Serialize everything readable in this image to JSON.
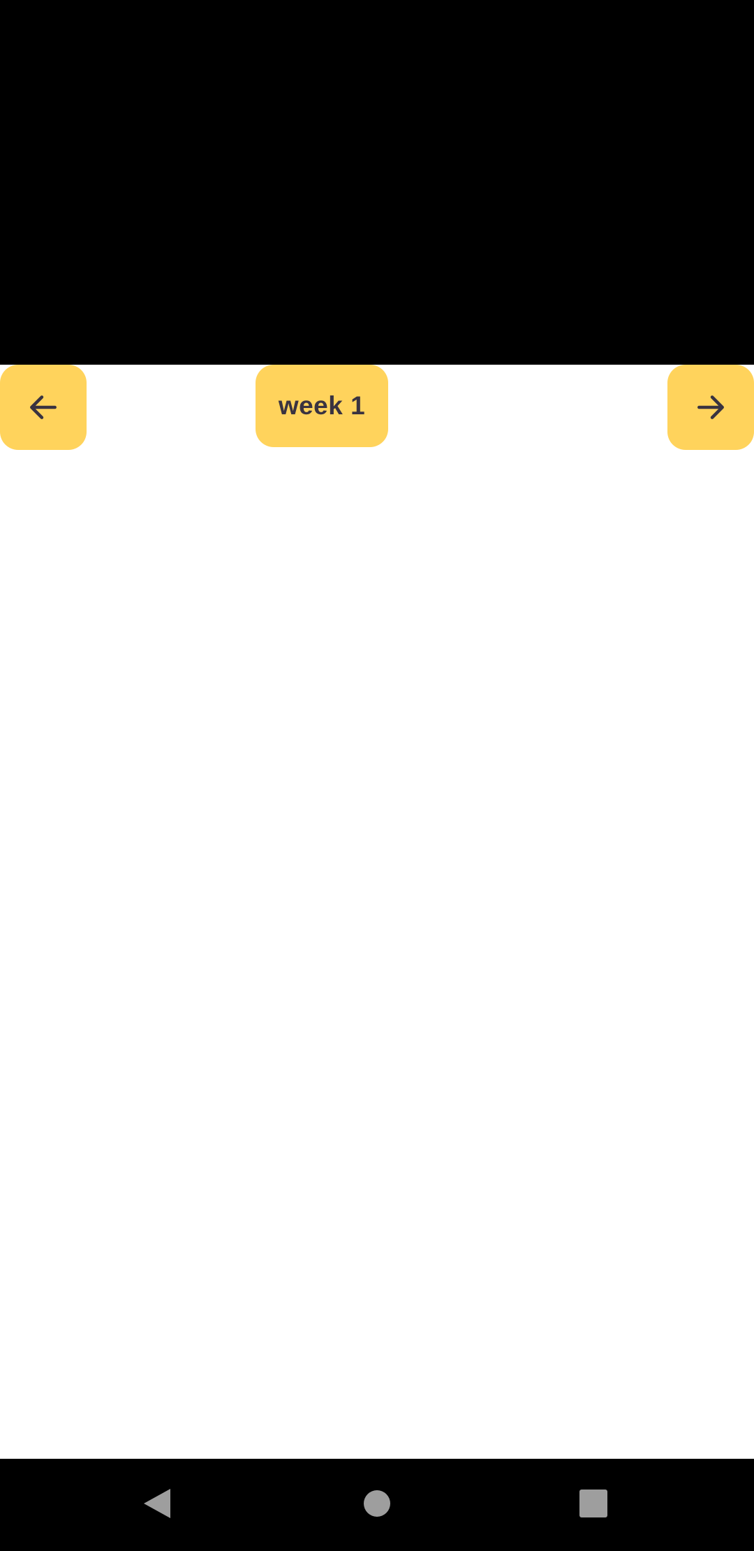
{
  "week_nav": {
    "prev_icon": "arrow-left-icon",
    "week_label": "week 1",
    "next_icon": "arrow-right-icon"
  },
  "system_nav": {
    "back_icon": "triangle-back-icon",
    "home_icon": "circle-home-icon",
    "recents_icon": "square-recents-icon"
  },
  "colors": {
    "accent": "#FFD35C",
    "icon_text": "#3A3340",
    "system_bar": "#000000",
    "system_icons": "#9E9E9E"
  }
}
